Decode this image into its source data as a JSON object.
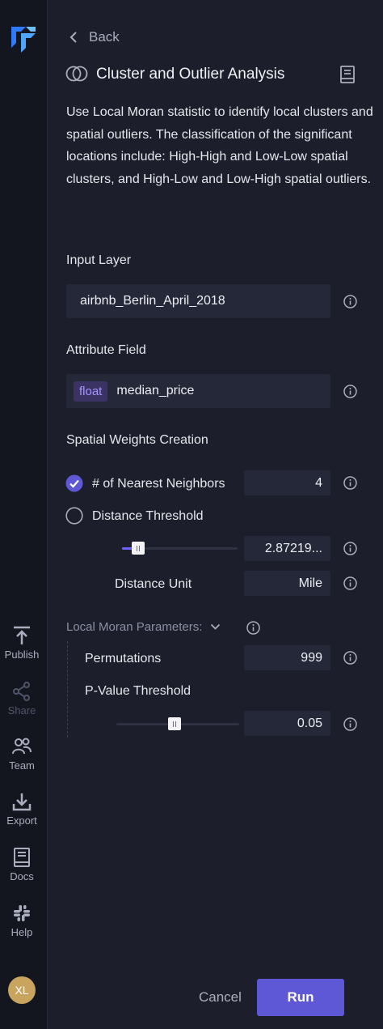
{
  "sidebar": {
    "items": [
      {
        "label": "Publish",
        "icon": "publish-icon"
      },
      {
        "label": "Share",
        "icon": "share-icon"
      },
      {
        "label": "Team",
        "icon": "team-icon"
      },
      {
        "label": "Export",
        "icon": "export-icon"
      },
      {
        "label": "Docs",
        "icon": "docs-icon"
      },
      {
        "label": "Help",
        "icon": "help-icon"
      }
    ],
    "avatar": "XL"
  },
  "header": {
    "back_label": "Back",
    "title": "Cluster and Outlier Analysis",
    "description": "Use Local Moran statistic to identify local clusters and spatial outliers. The classification of the significant locations include: High-High and Low-Low spatial clusters, and High-Low and Low-High spatial outliers."
  },
  "form": {
    "input_layer_label": "Input Layer",
    "input_layer_value": "airbnb_Berlin_April_2018",
    "attribute_field_label": "Attribute Field",
    "attribute_type_badge": "float",
    "attribute_value": "median_price",
    "weights_label": "Spatial Weights Creation",
    "knn_option_label": "# of Nearest Neighbors",
    "knn_value": "4",
    "knn_selected": true,
    "distance_option_label": "Distance Threshold",
    "distance_value": "2.87219...",
    "distance_slider_fraction": 0.05,
    "distance_unit_label": "Distance Unit",
    "distance_unit_value": "Mile",
    "moran_params_label": "Local Moran Parameters:",
    "permutations_label": "Permutations",
    "permutations_value": "999",
    "pvalue_label": "P-Value Threshold",
    "pvalue_value": "0.05",
    "pvalue_slider_fraction": 0.05
  },
  "footer": {
    "cancel_label": "Cancel",
    "run_label": "Run"
  },
  "colors": {
    "accent": "#5e58d6",
    "panel_bg": "#1c1f2b",
    "sidebar_bg": "#14161f",
    "field_bg": "#252838",
    "badge_text": "#a894ff"
  }
}
